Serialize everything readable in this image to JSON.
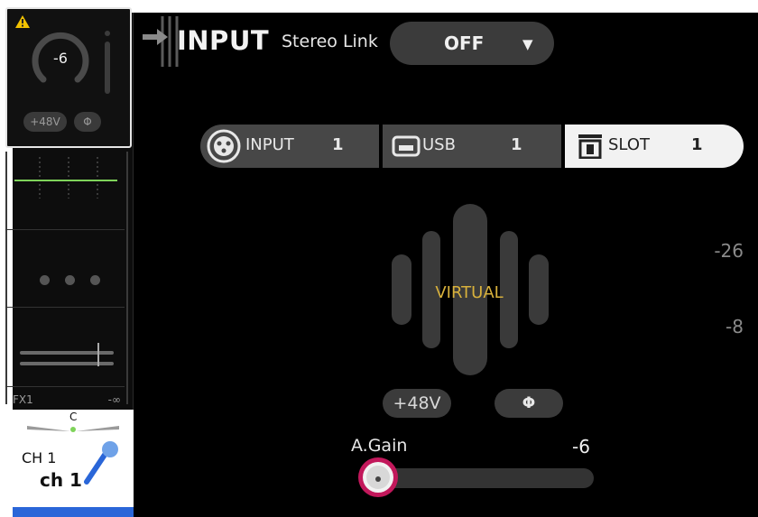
{
  "strip": {
    "gain_value": "-6",
    "phantom_label": "+48V",
    "phase_label": "Φ",
    "eq_value": "-26",
    "fader_value": "-8",
    "fx_label": "FX1",
    "fx_value": "-∞",
    "pan_label": "C",
    "channel_id": "CH 1",
    "channel_name": "ch 1"
  },
  "header": {
    "title": "INPUT",
    "stereo_link_label": "Stereo Link",
    "stereo_link_value": "OFF"
  },
  "source": {
    "items": [
      {
        "label": "INPUT",
        "number": "1",
        "selected": false
      },
      {
        "label": "USB",
        "number": "1",
        "selected": false
      },
      {
        "label": "SLOT",
        "number": "1",
        "selected": true
      }
    ]
  },
  "virtual_label": "VIRTUAL",
  "buttons": {
    "phantom": "+48V",
    "phase": "Φ"
  },
  "gain": {
    "label": "A.Gain",
    "value": "-6"
  },
  "colors": {
    "background": "#000000",
    "button": "#3b3b3b",
    "selected_segment": "#f2f2f2",
    "virtual_text": "#d8b13c",
    "knob_accent": "#c2185b",
    "channel_blue": "#2a66d8",
    "warning": "#f2c200"
  }
}
